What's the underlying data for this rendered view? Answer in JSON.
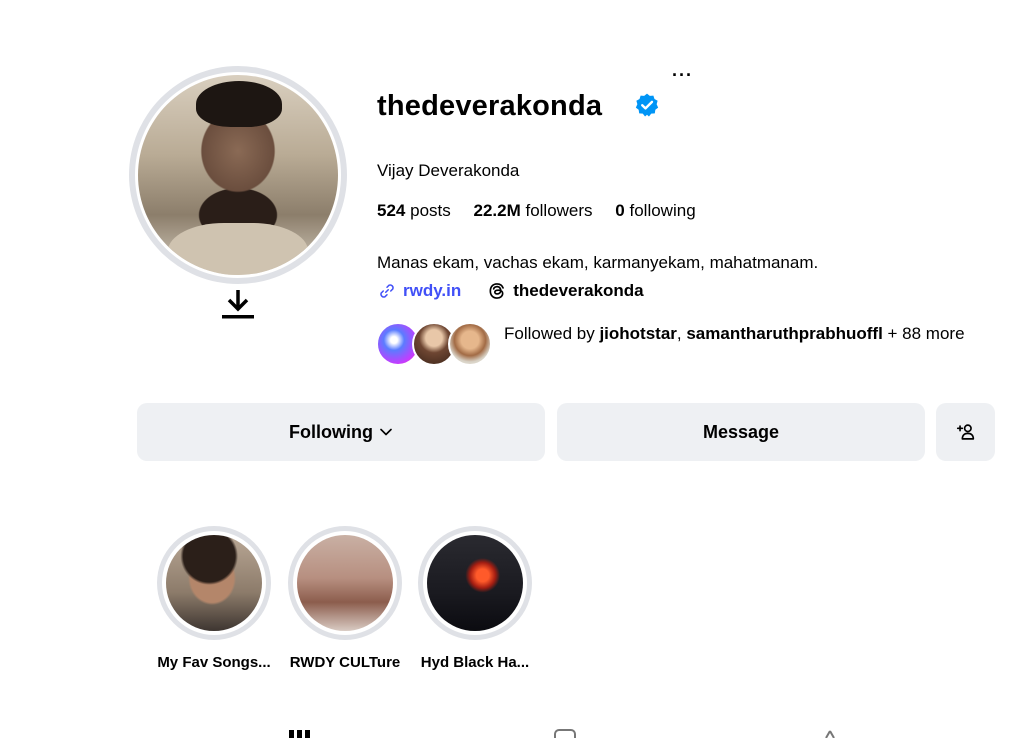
{
  "profile": {
    "username": "thedeverakonda",
    "verified": true,
    "full_name": "Vijay Deverakonda",
    "stats": [
      {
        "value": "524",
        "label": "posts"
      },
      {
        "value": "22.2M",
        "label": "followers"
      },
      {
        "value": "0",
        "label": "following"
      }
    ],
    "bio": "Manas ekam, vachas ekam, karmanyekam, mahatmanam.",
    "link": "rwdy.in",
    "threads": "thedeverakonda",
    "followed_by": {
      "prefix": "Followed by ",
      "user1": "jiohotstar",
      "sep": ", ",
      "user2": "samantharuthprabhuoffl",
      "suffix": " + 88 more"
    }
  },
  "buttons": {
    "following": "Following",
    "message": "Message"
  },
  "highlights": [
    {
      "label": "My Fav Songs..."
    },
    {
      "label": "RWDY CULTure"
    },
    {
      "label": "Hyd Black Ha..."
    }
  ],
  "colors": {
    "link": "#4150f7",
    "verified": "#0095f6",
    "button_bg": "#eef0f3"
  },
  "icons": {
    "more": "more-options-icon",
    "download": "download-icon",
    "verified": "verified-badge-icon",
    "link": "link-icon",
    "threads": "threads-icon",
    "chevron": "chevron-down-icon",
    "add_user": "add-person-icon"
  }
}
